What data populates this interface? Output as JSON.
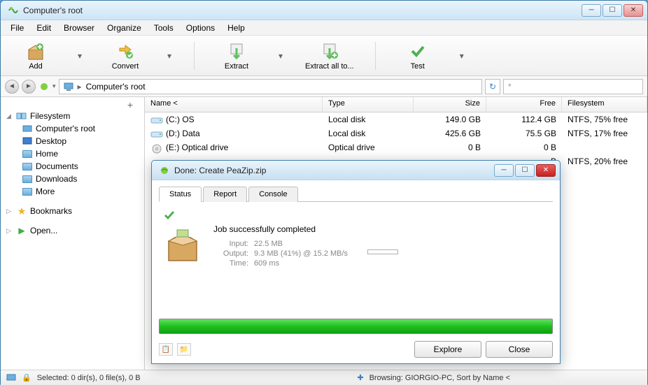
{
  "window": {
    "title": "Computer's root"
  },
  "menu": [
    "File",
    "Edit",
    "Browser",
    "Organize",
    "Tools",
    "Options",
    "Help"
  ],
  "toolbar": {
    "add": "Add",
    "convert": "Convert",
    "extract": "Extract",
    "extract_all": "Extract all to...",
    "test": "Test"
  },
  "address": {
    "path": "Computer's root",
    "search_placeholder": "*"
  },
  "tree": {
    "filesystem": "Filesystem",
    "items": [
      "Computer's root",
      "Desktop",
      "Home",
      "Documents",
      "Downloads",
      "More"
    ],
    "bookmarks": "Bookmarks",
    "open": "Open..."
  },
  "grid": {
    "headers": {
      "name": "Name <",
      "type": "Type",
      "size": "Size",
      "free": "Free",
      "fs": "Filesystem"
    },
    "rows": [
      {
        "name": "(C:) OS",
        "type": "Local disk",
        "size": "149.0 GB",
        "free": "112.4 GB",
        "fs": "NTFS, 75% free",
        "icon": "hdd"
      },
      {
        "name": "(D:) Data",
        "type": "Local disk",
        "size": "425.6 GB",
        "free": "75.5 GB",
        "fs": "NTFS, 17% free",
        "icon": "hdd"
      },
      {
        "name": "(E:) Optical drive",
        "type": "Optical drive",
        "size": "0 B",
        "free": "0 B",
        "fs": "",
        "icon": "cd"
      },
      {
        "name": "",
        "type": "",
        "size": "",
        "free": "B",
        "fs": "NTFS, 20% free",
        "icon": ""
      }
    ]
  },
  "status": {
    "selected": "Selected: 0 dir(s), 0 file(s), 0 B",
    "browsing": "Browsing: GIORGIO-PC, Sort by Name <"
  },
  "dialog": {
    "title": "Done: Create PeaZip.zip",
    "tabs": [
      "Status",
      "Report",
      "Console"
    ],
    "message": "Job successfully completed",
    "input_label": "Input:",
    "input_value": "22.5 MB",
    "output_label": "Output:",
    "output_value": "9.3 MB (41%) @ 15.2 MB/s",
    "time_label": "Time:",
    "time_value": "609 ms",
    "explore": "Explore",
    "close": "Close"
  }
}
